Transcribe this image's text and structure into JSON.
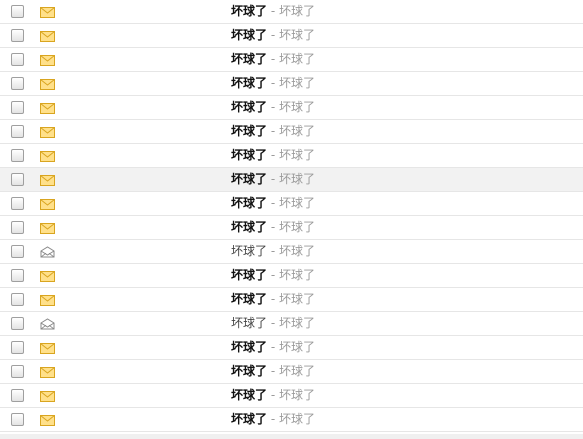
{
  "messages": [
    {
      "sender": "坏球了",
      "separator": "-",
      "preview": "坏球了",
      "read": false,
      "icon": "unread-envelope-icon"
    },
    {
      "sender": "坏球了",
      "separator": "-",
      "preview": "坏球了",
      "read": false,
      "icon": "unread-envelope-icon"
    },
    {
      "sender": "坏球了",
      "separator": "-",
      "preview": "坏球了",
      "read": false,
      "icon": "unread-envelope-icon"
    },
    {
      "sender": "坏球了",
      "separator": "-",
      "preview": "坏球了",
      "read": false,
      "icon": "unread-envelope-icon"
    },
    {
      "sender": "坏球了",
      "separator": "-",
      "preview": "坏球了",
      "read": false,
      "icon": "unread-envelope-icon"
    },
    {
      "sender": "坏球了",
      "separator": "-",
      "preview": "坏球了",
      "read": false,
      "icon": "unread-envelope-icon"
    },
    {
      "sender": "坏球了",
      "separator": "-",
      "preview": "坏球了",
      "read": false,
      "icon": "unread-envelope-icon"
    },
    {
      "sender": "坏球了",
      "separator": "-",
      "preview": "坏球了",
      "read": false,
      "icon": "unread-envelope-icon",
      "highlighted": true
    },
    {
      "sender": "坏球了",
      "separator": "-",
      "preview": "坏球了",
      "read": false,
      "icon": "unread-envelope-icon"
    },
    {
      "sender": "坏球了",
      "separator": "-",
      "preview": "坏球了",
      "read": false,
      "icon": "unread-envelope-icon"
    },
    {
      "sender": "坏球了",
      "separator": "-",
      "preview": "坏球了",
      "read": true,
      "icon": "read-envelope-icon"
    },
    {
      "sender": "坏球了",
      "separator": "-",
      "preview": "坏球了",
      "read": false,
      "icon": "unread-envelope-icon"
    },
    {
      "sender": "坏球了",
      "separator": "-",
      "preview": "坏球了",
      "read": false,
      "icon": "unread-envelope-icon"
    },
    {
      "sender": "坏球了",
      "separator": "-",
      "preview": "坏球了",
      "read": true,
      "icon": "read-envelope-icon"
    },
    {
      "sender": "坏球了",
      "separator": "-",
      "preview": "坏球了",
      "read": false,
      "icon": "unread-envelope-icon"
    },
    {
      "sender": "坏球了",
      "separator": "-",
      "preview": "坏球了",
      "read": false,
      "icon": "unread-envelope-icon"
    },
    {
      "sender": "坏球了",
      "separator": "-",
      "preview": "坏球了",
      "read": false,
      "icon": "unread-envelope-icon"
    },
    {
      "sender": "坏球了",
      "separator": "-",
      "preview": "坏球了",
      "read": false,
      "icon": "unread-envelope-icon"
    }
  ],
  "colors": {
    "unread_envelope_fill": "#ffe08a",
    "unread_envelope_stroke": "#d9a520",
    "read_envelope_fill": "#ffffff",
    "read_envelope_stroke": "#8a8a8a",
    "highlight_row": "#f2f2f2",
    "row_border": "#e6e6e6"
  }
}
